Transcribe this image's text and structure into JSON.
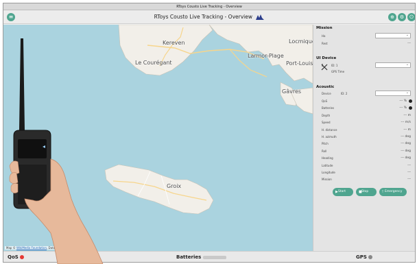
{
  "window": {
    "title": "RToys Cousto Live Tracking - Overview"
  },
  "header": {
    "title": "RToys Cousto Live Tracking - Overview"
  },
  "map": {
    "places": [
      "Kereven",
      "Locmiqué",
      "Larmor-Plage",
      "Le Courégant",
      "Port-Louis",
      "Gâvres",
      "Groix"
    ],
    "attribution_prefix": "Map © ",
    "attribution_link": "WikiMedia Foundation",
    "attribution_rest": ", Data"
  },
  "panel": {
    "mission": {
      "title": "Mission",
      "rows": [
        "Ha",
        "Rest"
      ],
      "rest_value": "---"
    },
    "ui_device": {
      "title": "UI Device",
      "id_label": "ID: 1",
      "gps_label": "GPS Time"
    },
    "acoustic": {
      "title": "Acoustic",
      "device_label": "Device",
      "device_id": "ID: 2",
      "rows": [
        {
          "label": "QoS",
          "value": "--- %"
        },
        {
          "label": "Batteries",
          "value": "--- %"
        },
        {
          "label": "Depth",
          "value": "--- m"
        },
        {
          "label": "Speed",
          "value": "--- m/s"
        },
        {
          "label": "H. distance",
          "value": "--- m"
        },
        {
          "label": "H. azimuth",
          "value": "--- deg"
        },
        {
          "label": "Pitch",
          "value": "--- deg"
        },
        {
          "label": "Roll",
          "value": "--- deg"
        },
        {
          "label": "Heading",
          "value": "--- deg"
        },
        {
          "label": "Latitude",
          "value": "---"
        },
        {
          "label": "Longitude",
          "value": "---"
        },
        {
          "label": "Mission",
          "value": "---"
        }
      ]
    },
    "buttons": {
      "start": "Start",
      "stop": "Stop",
      "emergency": "Emergency"
    }
  },
  "status": {
    "qos": "QoS",
    "batteries": "Batteries",
    "gps": "GPS"
  },
  "colors": {
    "accent": "#4fa58f",
    "sea": "#aad3df",
    "land": "#f2efe9",
    "qos": "#e53935"
  }
}
